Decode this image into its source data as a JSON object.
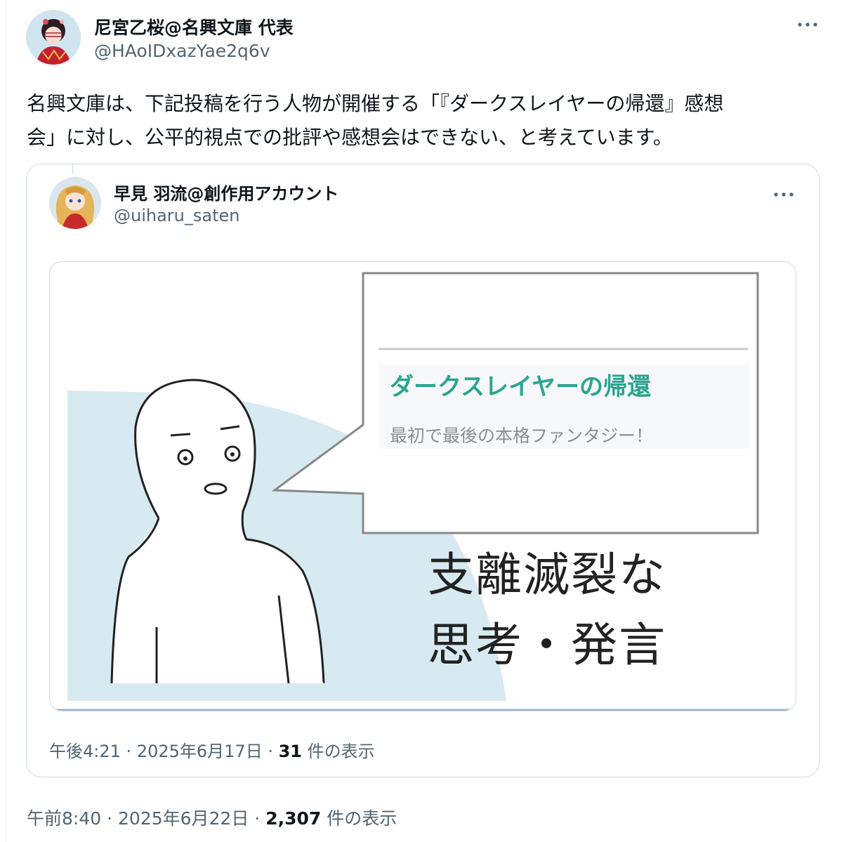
{
  "tweet": {
    "author_name": "尼宮乙桜@名興文庫 代表",
    "author_handle": "@HAoIDxazYae2q6v",
    "more_icon": "more-icon",
    "text_line1": "名興文庫は、下記投稿を行う人物が開催する「『ダークスレイヤーの帰還』感想",
    "text_line2": "会」に対し、公平的視点での批評や感想会はできない、と考えています。",
    "time": "午前8:40",
    "date": "2025年6月22日",
    "views_count": "2,307",
    "views_label": "件の表示"
  },
  "quoted": {
    "author_name": "早見 羽流@創作用アカウント",
    "author_handle": "@uiharu_saten",
    "more_icon": "more-icon",
    "image": {
      "bubble_title": "ダークスレイヤーの帰還",
      "bubble_subtitle": "最初で最後の本格ファンタジー！",
      "caption_line1": "支離滅裂な",
      "caption_line2": "思考・発言"
    },
    "time": "午後4:21",
    "date": "2025年6月17日",
    "views_count": "31",
    "views_label": "件の表示"
  },
  "colors": {
    "accent_title": "#2aa58f",
    "muted": "#536471",
    "border": "#cfd9de",
    "image_bg": "#d7eaf1"
  }
}
